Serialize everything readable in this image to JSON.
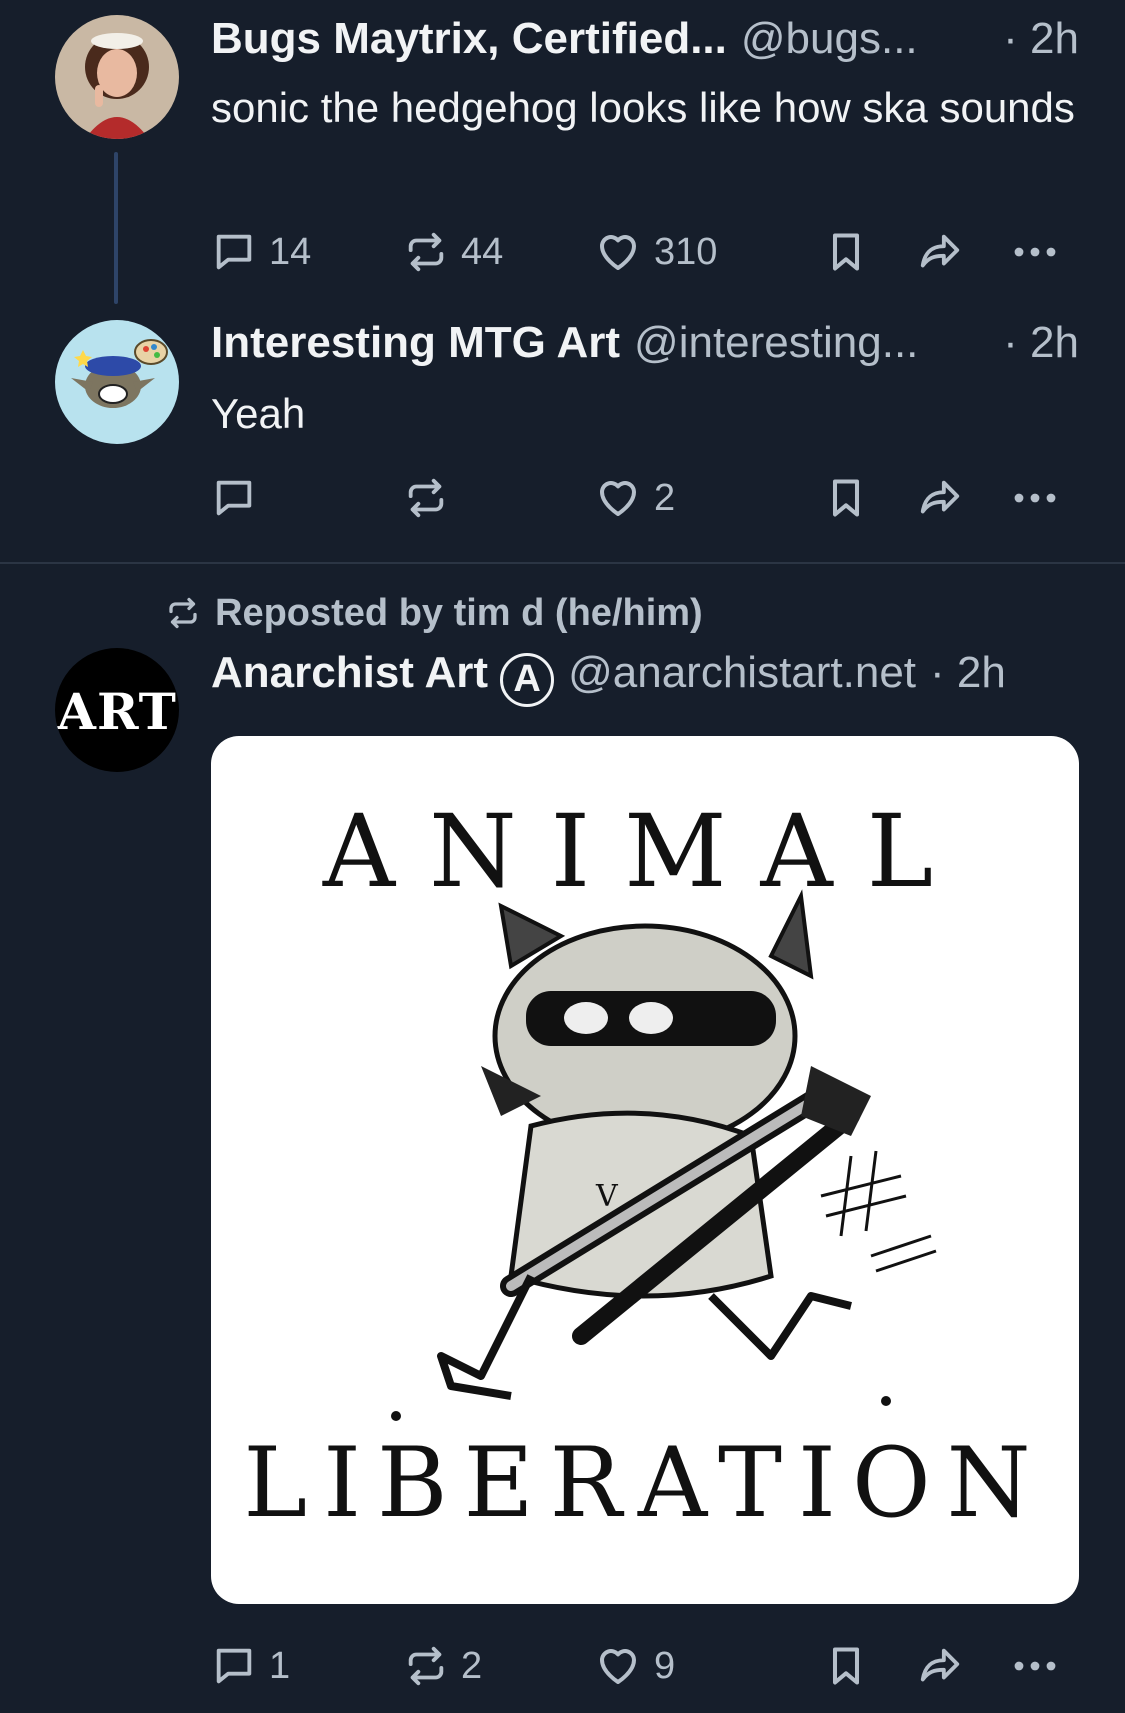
{
  "posts": [
    {
      "author": "Bugs Maytrix, Certified...",
      "handle": "@bugs...",
      "time": "· 2h",
      "text": "sonic the hedgehog looks like how ska sounds",
      "replies": "14",
      "reposts": "44",
      "likes": "310"
    },
    {
      "author": "Interesting MTG Art",
      "handle": "@interesting...",
      "time": "· 2h",
      "text": "Yeah",
      "replies": "",
      "reposts": "",
      "likes": "2"
    },
    {
      "repost_label": "Reposted by tim d (he/him)",
      "author": "Anarchist Art",
      "author_badge": "A",
      "handle": "@anarchistart.net",
      "time": "· 2h",
      "avatar_text": "ART",
      "image": {
        "top_text": "ANIMAL",
        "bottom_text": "LIBERATION",
        "shirt_letter": "V"
      },
      "replies": "1",
      "reposts": "2",
      "likes": "9"
    }
  ],
  "icons": {
    "reply": "speech-bubble-icon",
    "repost": "repost-arrows-icon",
    "like": "heart-outline-icon",
    "bookmark": "bookmark-icon",
    "share": "share-arrow-icon",
    "more": "ellipsis-icon"
  },
  "colors": {
    "background": "#161e2b",
    "text_primary": "#f1f3f5",
    "text_secondary": "#b5bfca",
    "thread_line": "#2e4468",
    "divider": "#2b3544"
  }
}
